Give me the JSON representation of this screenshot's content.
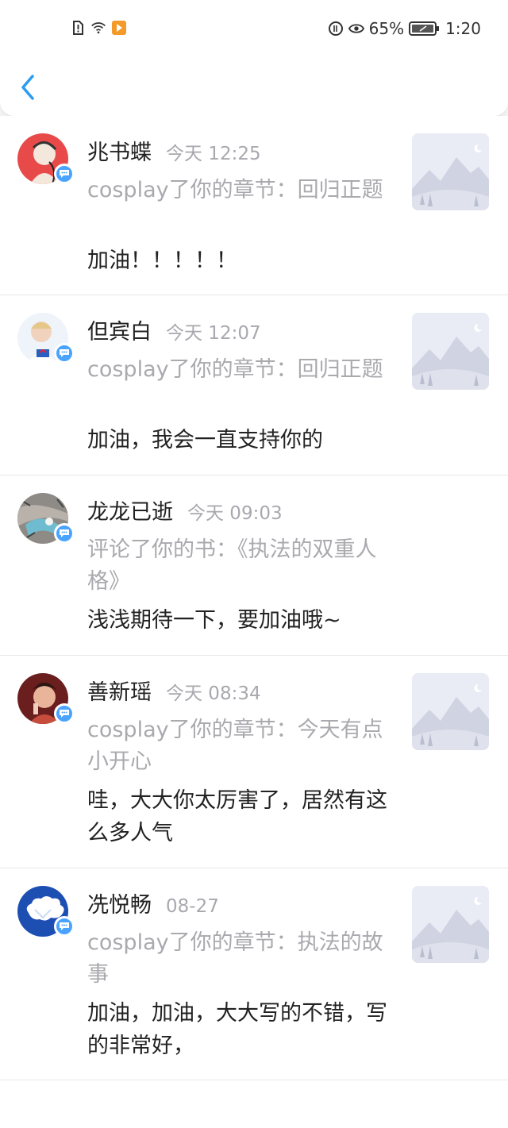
{
  "status_bar": {
    "battery": "65%",
    "time": "1:20"
  },
  "notifications": [
    {
      "name": "兆书蝶",
      "time": "今天 12:25",
      "action": "cosplay了你的章节：回归正题",
      "comment": "加油！！！！！",
      "has_thumbnail": true
    },
    {
      "name": "但宾白",
      "time": "今天 12:07",
      "action": "cosplay了你的章节：回归正题",
      "comment": "加油，我会一直支持你的",
      "has_thumbnail": true
    },
    {
      "name": "龙龙已逝",
      "time": "今天 09:03",
      "action": "评论了你的书：《执法的双重人格》",
      "comment": "浅浅期待一下，要加油哦~",
      "has_thumbnail": false
    },
    {
      "name": "善新瑶",
      "time": "今天 08:34",
      "action": "cosplay了你的章节：今天有点小开心",
      "comment": "哇，大大你太厉害了，居然有这么多人气",
      "has_thumbnail": true
    },
    {
      "name": "冼悦畅",
      "time": "08-27",
      "action": "cosplay了你的章节：执法的故事",
      "comment": "加油，加油，大大写的不错，写的非常好，",
      "has_thumbnail": true
    }
  ],
  "colors": {
    "accent": "#2b9cf2",
    "badge": "#4aa3ff",
    "secondary_text": "#a9a9ae"
  }
}
